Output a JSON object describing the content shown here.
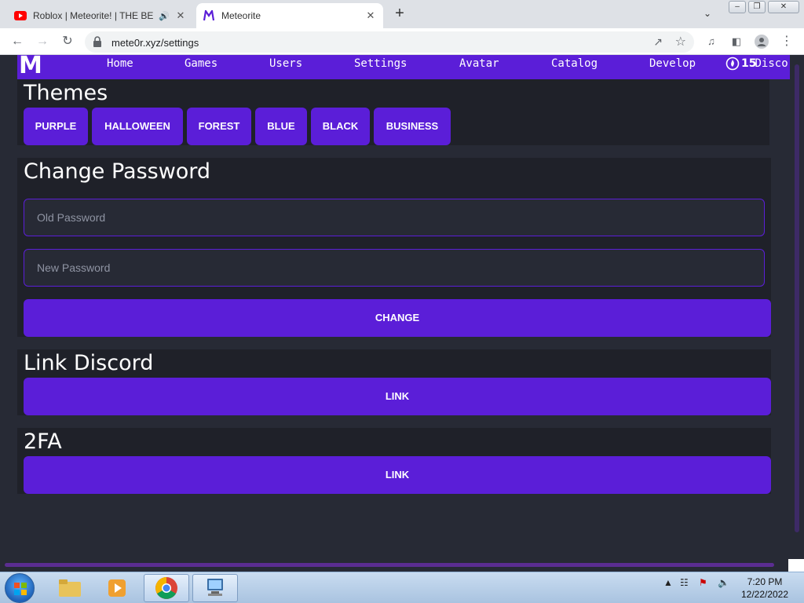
{
  "browser": {
    "tabs": [
      {
        "title": "Roblox | Meteorite! | THE BE",
        "active": false,
        "audio_icon": "speaker-icon"
      },
      {
        "title": "Meteorite",
        "active": true
      }
    ],
    "url": "mete0r.xyz/settings"
  },
  "site": {
    "logo": "M",
    "nav": [
      "Home",
      "Games",
      "Users",
      "Settings",
      "Avatar",
      "Catalog",
      "Develop"
    ],
    "currency_count": "15",
    "nav_extra": "Discor"
  },
  "themes": {
    "title": "Themes",
    "options": [
      "PURPLE",
      "HALLOWEEN",
      "FOREST",
      "BLUE",
      "BLACK",
      "BUSINESS"
    ]
  },
  "change_password": {
    "title": "Change Password",
    "old_placeholder": "Old Password",
    "new_placeholder": "New Password",
    "button": "CHANGE"
  },
  "link_discord": {
    "title": "Link Discord",
    "button": "LINK"
  },
  "twofa": {
    "title": "2FA",
    "button": "LINK"
  },
  "taskbar": {
    "time": "7:20 PM",
    "date": "12/22/2022"
  },
  "colors": {
    "accent": "#5b1ed8",
    "background": "#272a35",
    "card": "#1f2129"
  }
}
